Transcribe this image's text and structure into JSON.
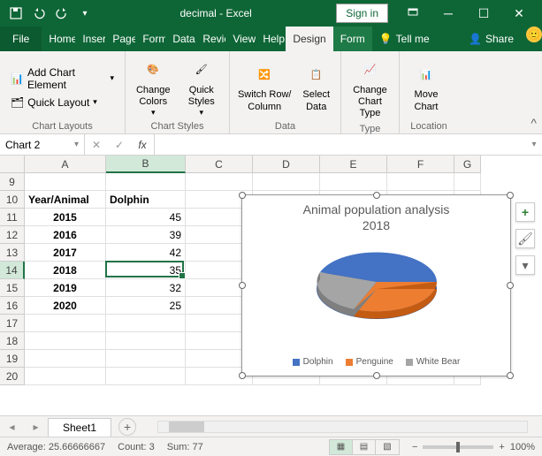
{
  "app": {
    "title": "decimal  -  Excel",
    "signin": "Sign in"
  },
  "tabs": {
    "file": "File",
    "items": [
      "Home",
      "Insert",
      "Page",
      "Form",
      "Data",
      "Revie",
      "View",
      "Help"
    ],
    "ctx": [
      "Design",
      "Form"
    ],
    "tellme": "Tell me",
    "share": "Share"
  },
  "ribbon": {
    "layouts": {
      "add": "Add Chart Element",
      "quick": "Quick Layout",
      "label": "Chart Layouts"
    },
    "styles": {
      "colors": "Change Colors",
      "quick": "Quick Styles",
      "label": "Chart Styles"
    },
    "data": {
      "switch": "Switch Row/ Column",
      "select": "Select Data",
      "label": "Data"
    },
    "type": {
      "change": "Change Chart Type",
      "label": "Type"
    },
    "loc": {
      "move": "Move Chart",
      "label": "Location"
    }
  },
  "namebox": "Chart 2",
  "columns": [
    "A",
    "B",
    "C",
    "D",
    "E",
    "F",
    "G"
  ],
  "rows": [
    "9",
    "10",
    "11",
    "12",
    "13",
    "14",
    "15",
    "16",
    "17",
    "18",
    "19",
    "20"
  ],
  "table": {
    "headerA": "Year/Animal",
    "headerB": "Dolphin",
    "data": [
      {
        "y": "2015",
        "v": "45"
      },
      {
        "y": "2016",
        "v": "39"
      },
      {
        "y": "2017",
        "v": "42"
      },
      {
        "y": "2018",
        "v": "35"
      },
      {
        "y": "2019",
        "v": "32"
      },
      {
        "y": "2020",
        "v": "25"
      }
    ]
  },
  "chart": {
    "title1": "Animal population analysis",
    "title2": "2018",
    "legend": [
      "Dolphin",
      "Penguine",
      "White Bear"
    ],
    "colors": [
      "#4472c4",
      "#ed7d31",
      "#a5a5a5"
    ]
  },
  "chart_data": {
    "type": "pie",
    "title": "Animal population analysis 2018",
    "categories": [
      "Dolphin",
      "Penguine",
      "White Bear"
    ],
    "values": [
      35,
      25,
      17
    ],
    "colors": [
      "#4472c4",
      "#ed7d31",
      "#a5a5a5"
    ]
  },
  "sheet": {
    "name": "Sheet1"
  },
  "status": {
    "avg_label": "Average:",
    "avg": "25.66666667",
    "count_label": "Count:",
    "count": "3",
    "sum_label": "Sum:",
    "sum": "77",
    "zoom": "100%"
  }
}
